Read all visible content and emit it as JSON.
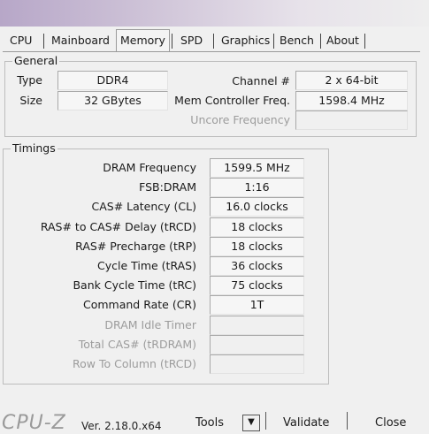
{
  "tabs": [
    "CPU",
    "Mainboard",
    "Memory",
    "SPD",
    "Graphics",
    "Bench",
    "About"
  ],
  "active_tab": "Memory",
  "general": {
    "title": "General",
    "type_label": "Type",
    "type_value": "DDR4",
    "size_label": "Size",
    "size_value": "32 GBytes",
    "channel_label": "Channel #",
    "channel_value": "2 x 64-bit",
    "memctrl_label": "Mem Controller Freq.",
    "memctrl_value": "1598.4 MHz",
    "uncore_label": "Uncore Frequency",
    "uncore_value": ""
  },
  "timings": {
    "title": "Timings",
    "rows": [
      {
        "label": "DRAM Frequency",
        "value": "1599.5 MHz",
        "enabled": true
      },
      {
        "label": "FSB:DRAM",
        "value": "1:16",
        "enabled": true
      },
      {
        "label": "CAS# Latency (CL)",
        "value": "16.0 clocks",
        "enabled": true
      },
      {
        "label": "RAS# to CAS# Delay (tRCD)",
        "value": "18 clocks",
        "enabled": true
      },
      {
        "label": "RAS# Precharge (tRP)",
        "value": "18 clocks",
        "enabled": true
      },
      {
        "label": "Cycle Time (tRAS)",
        "value": "36 clocks",
        "enabled": true
      },
      {
        "label": "Bank Cycle Time (tRC)",
        "value": "75 clocks",
        "enabled": true
      },
      {
        "label": "Command Rate (CR)",
        "value": "1T",
        "enabled": true
      },
      {
        "label": "DRAM Idle Timer",
        "value": "",
        "enabled": false
      },
      {
        "label": "Total CAS# (tRDRAM)",
        "value": "",
        "enabled": false
      },
      {
        "label": "Row To Column (tRCD)",
        "value": "",
        "enabled": false
      }
    ]
  },
  "footer": {
    "logo": "CPU-Z",
    "version": "Ver. 2.18.0.x64",
    "tools_label": "Tools",
    "validate_label": "Validate",
    "close_label": "Close"
  }
}
